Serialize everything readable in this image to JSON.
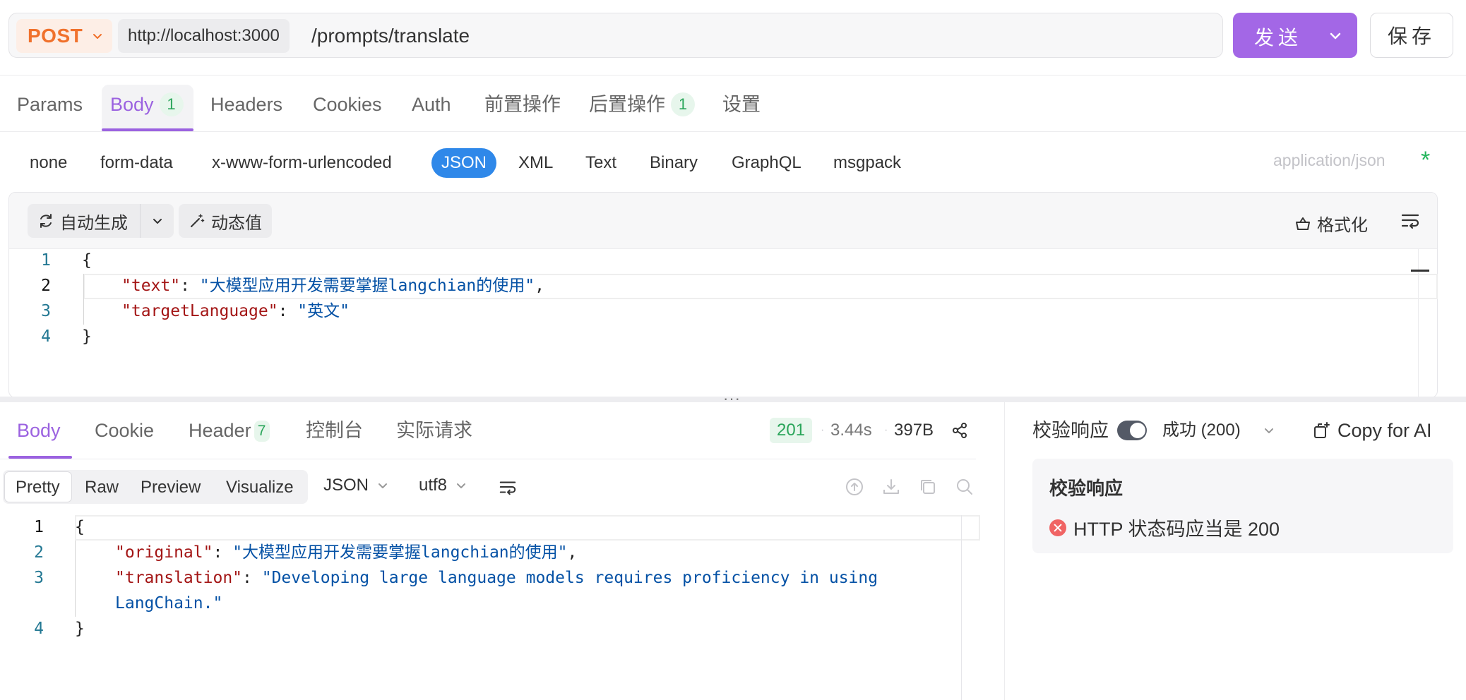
{
  "request": {
    "method": "POST",
    "host": "http://localhost:3000",
    "path": "/prompts/translate",
    "send_label": "发送",
    "save_label": "保存"
  },
  "request_tabs": [
    {
      "label": "Params"
    },
    {
      "label": "Body",
      "badge": "1",
      "active": true
    },
    {
      "label": "Headers"
    },
    {
      "label": "Cookies"
    },
    {
      "label": "Auth"
    },
    {
      "label": "前置操作"
    },
    {
      "label": "后置操作",
      "badge": "1"
    },
    {
      "label": "设置"
    }
  ],
  "body_types": [
    "none",
    "form-data",
    "x-www-form-urlencoded",
    "JSON",
    "XML",
    "Text",
    "Binary",
    "GraphQL",
    "msgpack"
  ],
  "body_type_active": "JSON",
  "content_type": "application/json",
  "content_type_required": "*",
  "editor_toolbar": {
    "auto_generate": "自动生成",
    "dynamic_value": "动态值",
    "format": "格式化"
  },
  "request_body": {
    "line_numbers": [
      "1",
      "2",
      "3",
      "4"
    ],
    "open": "{",
    "close": "}",
    "text_key": "\"text\"",
    "text_value": "\"大模型应用开发需要掌握langchian的使用\"",
    "lang_key": "\"targetLanguage\"",
    "lang_value": "\"英文\""
  },
  "response_tabs": [
    {
      "label": "Body",
      "active": true
    },
    {
      "label": "Cookie"
    },
    {
      "label": "Header",
      "badge": "7"
    },
    {
      "label": "控制台"
    },
    {
      "label": "实际请求"
    }
  ],
  "response_meta": {
    "status": "201",
    "time": "3.44s",
    "size": "397B",
    "separator": "·"
  },
  "view_modes": [
    "Pretty",
    "Raw",
    "Preview",
    "Visualize"
  ],
  "view_mode_active": "Pretty",
  "response_format": "JSON",
  "response_encoding": "utf8",
  "response_body": {
    "line_numbers": [
      "1",
      "2",
      "3",
      "4"
    ],
    "open": "{",
    "close": "}",
    "original_key": "\"original\"",
    "original_value": "\"大模型应用开发需要掌握langchian的使用\"",
    "translation_key": "\"translation\"",
    "translation_value_1": "\"Developing large language models requires proficiency in using",
    "translation_value_2": "LangChain.\""
  },
  "validation": {
    "label": "校验响应",
    "enabled": true,
    "status_option": "成功 (200)",
    "copy_for_ai": "Copy for AI",
    "card_title": "校验响应",
    "error": "HTTP 状态码应当是 200"
  },
  "colors": {
    "accent": "#9b62e0",
    "send_button": "#a367e6",
    "method": "#f0712c",
    "json_chip": "#2f88e9",
    "status_ok": "#2aa55a",
    "error": "#f06464"
  },
  "icons": [
    "chevron-down-icon",
    "refresh-icon",
    "magic-wand-icon",
    "basket-icon",
    "wrap-lines-icon",
    "share-icon",
    "upload-icon",
    "download-icon",
    "copy-icon",
    "search-icon",
    "copy-ai-icon",
    "error-icon"
  ]
}
